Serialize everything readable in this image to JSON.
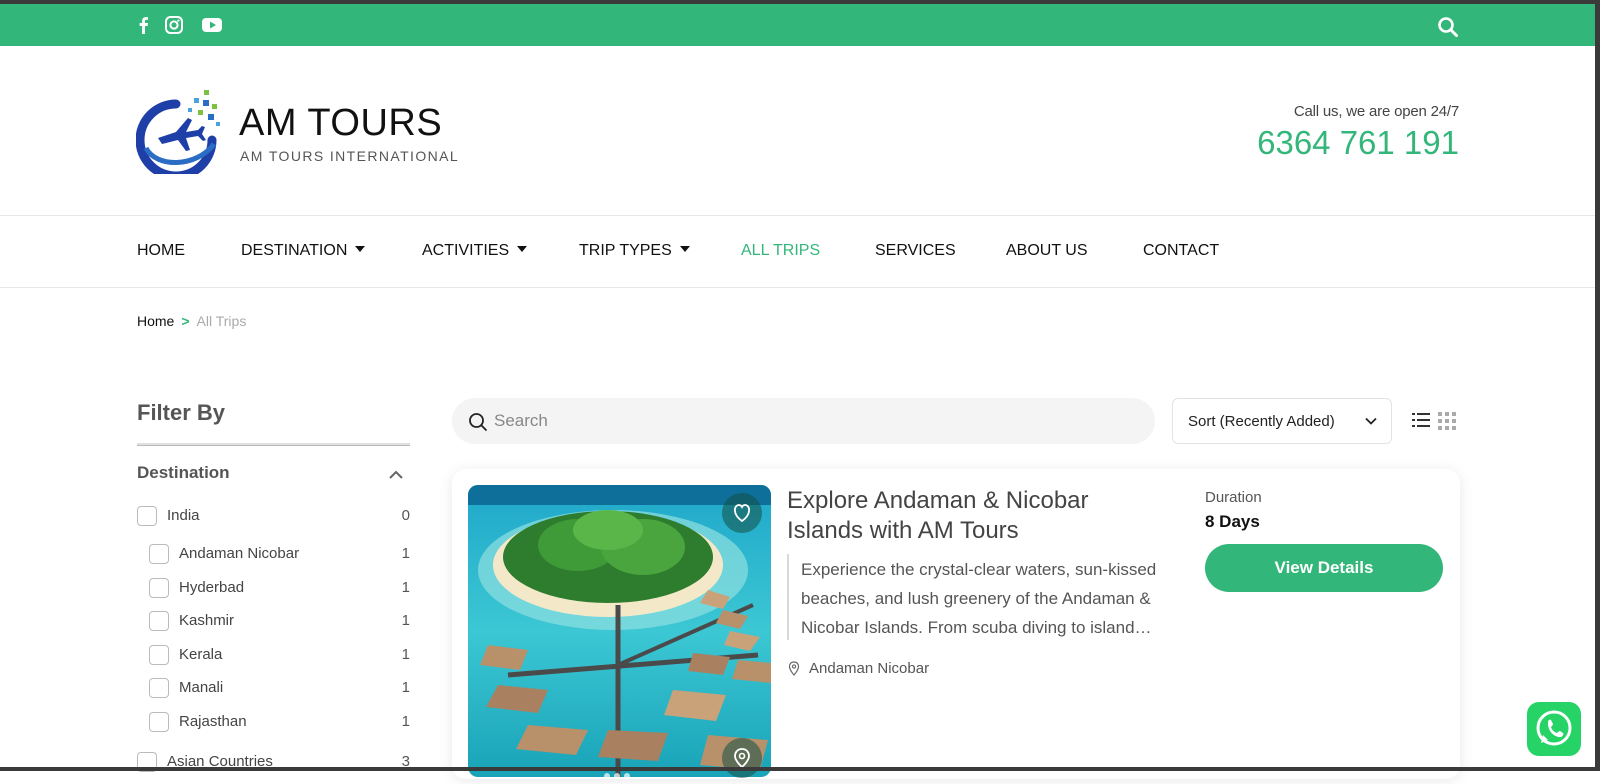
{
  "social": {
    "facebook": "f",
    "instagram": "instagram-icon",
    "youtube": "youtube-icon"
  },
  "brand": {
    "name": "AM TOURS",
    "tagline": "AM TOURS INTERNATIONAL"
  },
  "contact": {
    "label": "Call us, we are open 24/7",
    "phone": "6364 761 191"
  },
  "nav": {
    "items": [
      {
        "label": "HOME"
      },
      {
        "label": "DESTINATION"
      },
      {
        "label": "ACTIVITIES"
      },
      {
        "label": "TRIP TYPES"
      },
      {
        "label": "ALL TRIPS"
      },
      {
        "label": "SERVICES"
      },
      {
        "label": "ABOUT US"
      },
      {
        "label": "CONTACT"
      }
    ]
  },
  "breadcrumb": {
    "home": "Home",
    "separator": ">",
    "current": "All Trips"
  },
  "filters": {
    "title": "Filter By",
    "destination": {
      "label": "Destination",
      "items": [
        {
          "label": "India",
          "count": "0"
        },
        {
          "label": "Andaman Nicobar",
          "count": "1"
        },
        {
          "label": "Hyderbad",
          "count": "1"
        },
        {
          "label": "Kashmir",
          "count": "1"
        },
        {
          "label": "Kerala",
          "count": "1"
        },
        {
          "label": "Manali",
          "count": "1"
        },
        {
          "label": "Rajasthan",
          "count": "1"
        },
        {
          "label": "Asian Countries",
          "count": "3"
        }
      ]
    }
  },
  "toolbar": {
    "search_placeholder": "Search",
    "sort_label": "Sort (Recently Added)"
  },
  "trip": {
    "title": "Explore Andaman & Nicobar Islands with AM Tours",
    "description": "Experience the crystal-clear waters, sun-kissed beaches, and lush greenery of the Andaman & Nicobar Islands. From scuba diving to island hopping, enjoy an unforgettable getaway.",
    "location": "Andaman Nicobar",
    "duration_label": "Duration",
    "duration_value": "8 Days",
    "cta": "View Details"
  },
  "colors": {
    "accent": "#33b679",
    "logo_blue": "#1f3fa8",
    "logo_green": "#7cc242"
  }
}
